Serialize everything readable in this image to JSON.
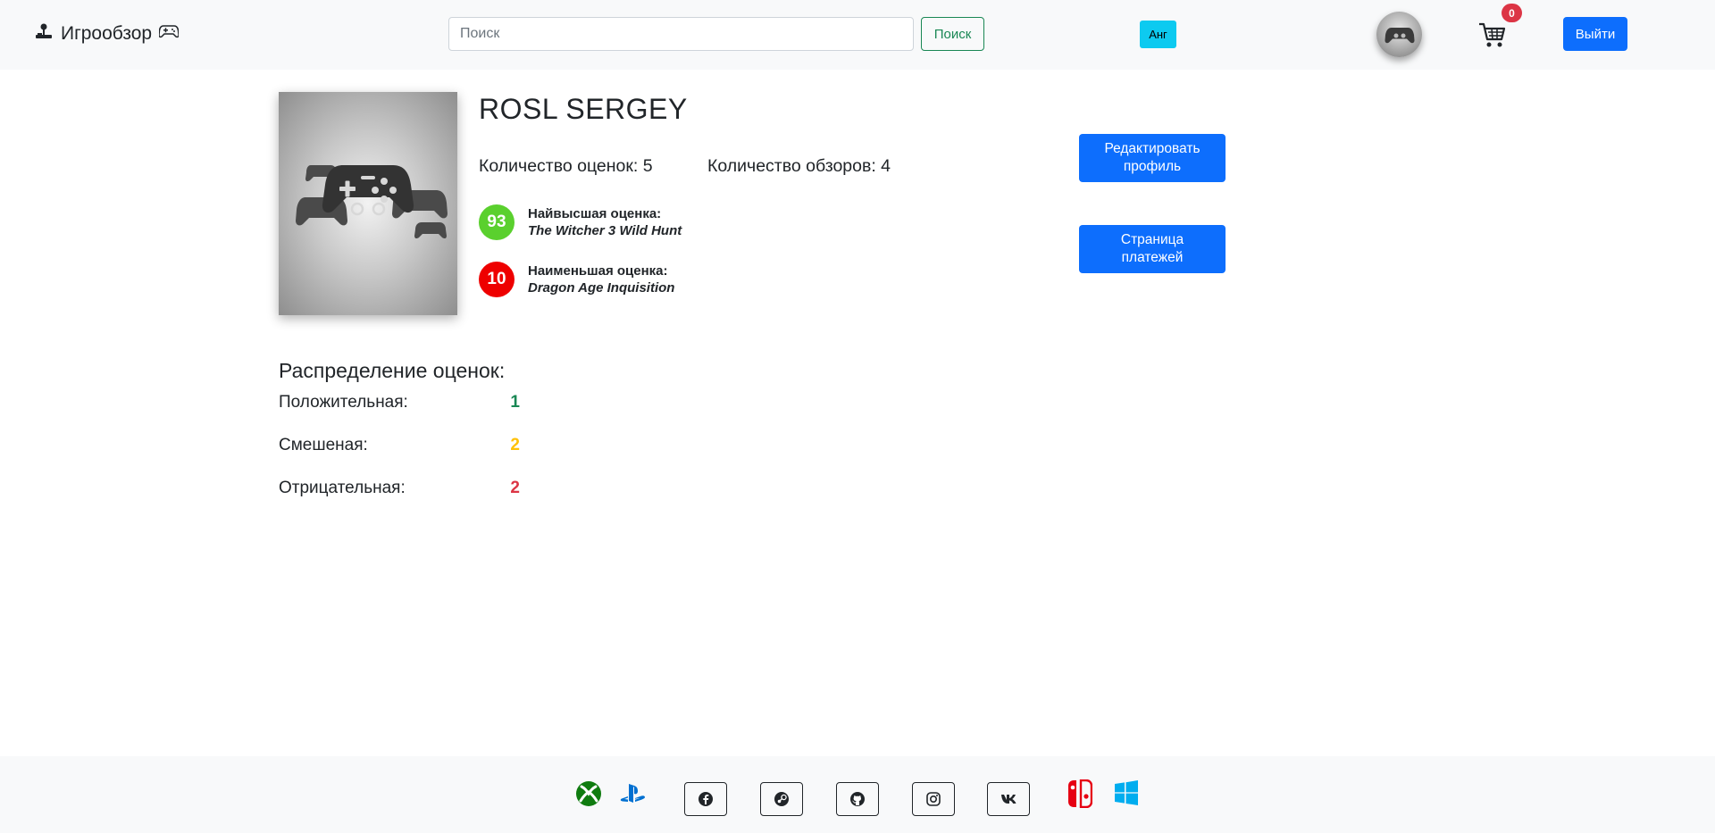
{
  "navbar": {
    "brand": "Игрообзор",
    "search_placeholder": "Поиск",
    "search_button": "Поиск",
    "lang_button": "Анг",
    "cart_count": "0",
    "logout_button": "Выйти"
  },
  "profile": {
    "name": "ROSL SERGEY",
    "ratings_count_text": "Количество оценок: 5",
    "reviews_count_text": "Количество обзоров: 4",
    "highest": {
      "score": "93",
      "label": "Найвысшая оценка:",
      "game": "The Witcher 3 Wild Hunt"
    },
    "lowest": {
      "score": "10",
      "label": "Наименьшая оценка:",
      "game": "Dragon Age Inquisition"
    },
    "edit_button": "Редактировать профиль",
    "payments_button": "Страница платежей"
  },
  "distribution": {
    "title": "Распределение оценок:",
    "rows": [
      {
        "label": "Положительная:",
        "value": "1",
        "color": "#198754"
      },
      {
        "label": "Смешеная:",
        "value": "2",
        "color": "#ffc107"
      },
      {
        "label": "Отрицательная:",
        "value": "2",
        "color": "#dc3545"
      }
    ]
  },
  "footer": {
    "icons": [
      "xbox-icon",
      "playstation-icon",
      "facebook-icon",
      "steam-icon",
      "github-icon",
      "instagram-icon",
      "vk-icon",
      "nintendo-switch-icon",
      "windows-icon"
    ]
  },
  "colors": {
    "primary": "#0d6efd",
    "success": "#198754",
    "info": "#0dcaf0",
    "danger": "#dc3545",
    "navbar_bg": "#f8f9fa"
  }
}
